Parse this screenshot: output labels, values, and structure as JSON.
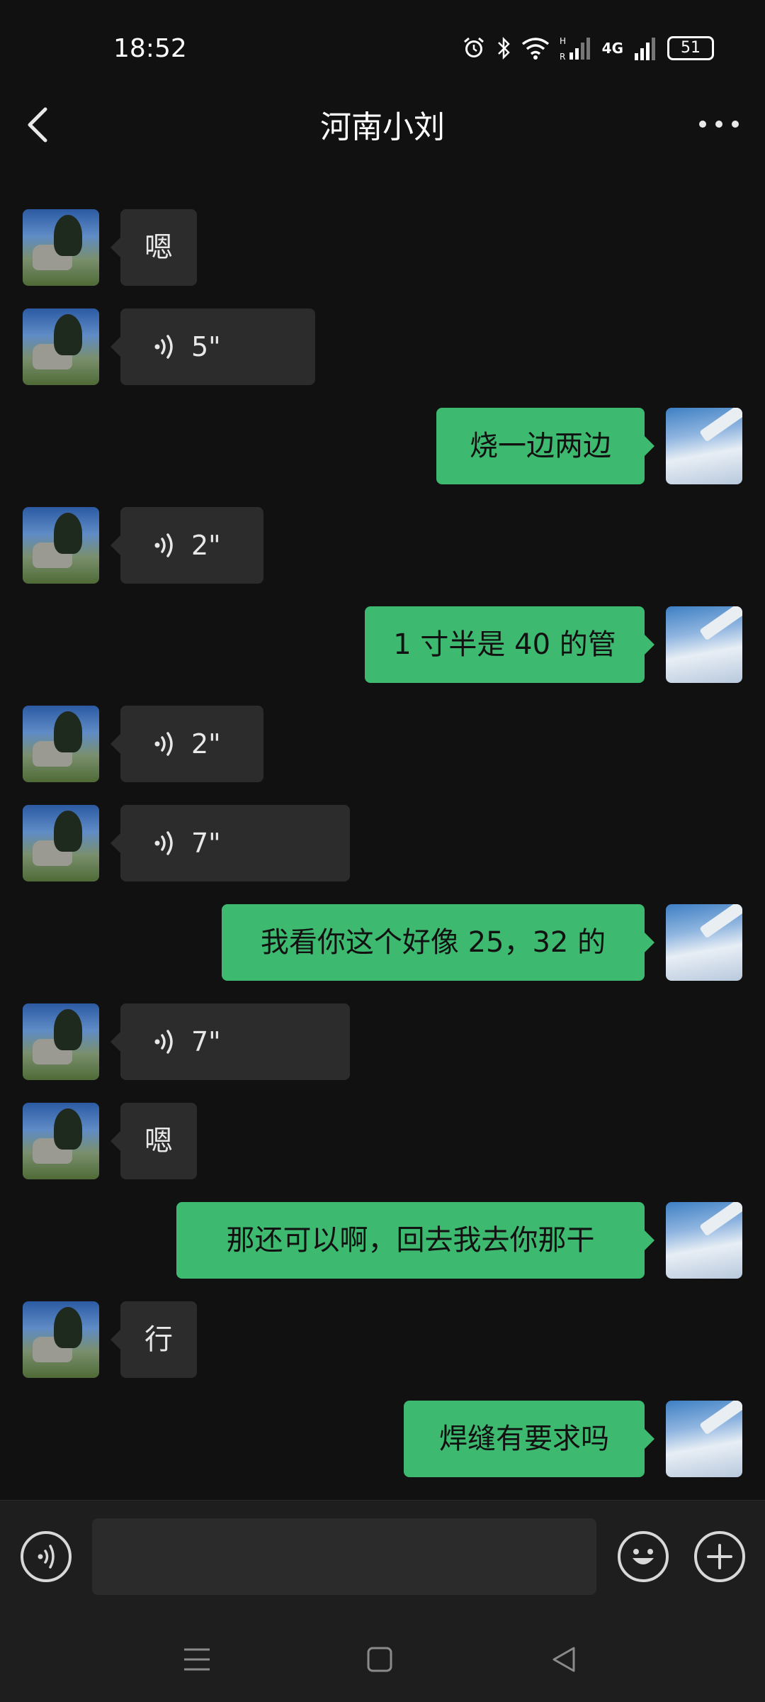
{
  "status_bar": {
    "time": "18:52",
    "network_label": "4G",
    "battery": "51",
    "icons": [
      "alarm-icon",
      "bluetooth-icon",
      "wifi-icon",
      "hd-signal-icon",
      "cell-signal-icon",
      "battery-icon"
    ]
  },
  "nav": {
    "title": "河南小刘",
    "back_icon": "chevron-left-icon",
    "more_icon": "more-dots-icon"
  },
  "messages": [
    {
      "side": "left",
      "type": "text",
      "text": "嗯"
    },
    {
      "side": "left",
      "type": "voice",
      "text": "5\""
    },
    {
      "side": "right",
      "type": "text",
      "text": "烧一边两边"
    },
    {
      "side": "left",
      "type": "voice",
      "text": "2\""
    },
    {
      "side": "right",
      "type": "text",
      "text": "1 寸半是 40 的管"
    },
    {
      "side": "left",
      "type": "voice",
      "text": "2\""
    },
    {
      "side": "left",
      "type": "voice",
      "text": "7\""
    },
    {
      "side": "right",
      "type": "text",
      "text": "我看你这个好像 25，32 的"
    },
    {
      "side": "left",
      "type": "voice",
      "text": "7\""
    },
    {
      "side": "left",
      "type": "text",
      "text": "嗯"
    },
    {
      "side": "right",
      "type": "text",
      "text": "那还可以啊，回去我去你那干"
    },
    {
      "side": "left",
      "type": "text",
      "text": "行"
    },
    {
      "side": "right",
      "type": "text",
      "text": "焊缝有要求吗"
    }
  ],
  "input_bar": {
    "voice_icon": "voice-toggle-icon",
    "input_value": "",
    "emoji_icon": "emoji-icon",
    "plus_icon": "plus-icon"
  },
  "system_nav": {
    "icons": [
      "menu-icon",
      "home-icon",
      "back-triangle-icon"
    ]
  },
  "colors": {
    "background": "#111111",
    "bubble_mine": "#3dba6f",
    "bubble_theirs": "#2c2c2c"
  }
}
